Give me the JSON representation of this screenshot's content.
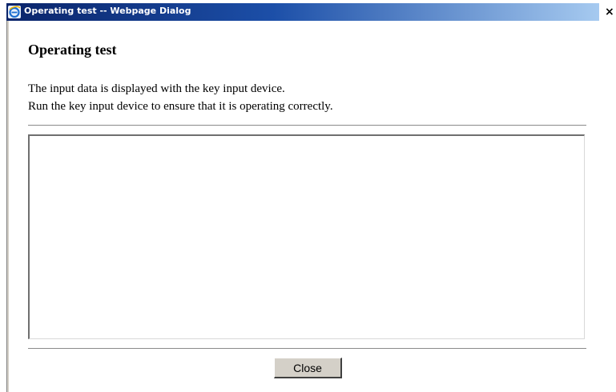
{
  "window": {
    "title": "Operating test -- Webpage Dialog",
    "close_glyph": "×"
  },
  "dialog": {
    "heading": "Operating test",
    "description_line1": "The input data is displayed with the key input device.",
    "description_line2": "Run the key input device to ensure that it is operating correctly.",
    "input_value": "",
    "close_label": "Close"
  },
  "colors": {
    "titlebar_start": "#0a246a",
    "titlebar_end": "#a6caf0",
    "button_face": "#d4d0c8"
  },
  "icons": {
    "title_icon": "internet-explorer-icon"
  }
}
